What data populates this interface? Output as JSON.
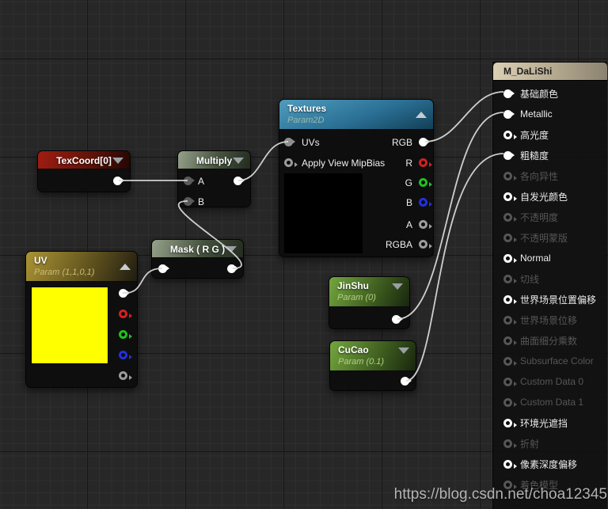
{
  "colors": {
    "canvas_bg": "#272727",
    "wire": "#d8d8d8",
    "header_texture_sample": "#2f7ca3",
    "header_constant_red": "#8a1410",
    "header_operator_green": "#5d7a3c",
    "header_param_green": "#5f9431",
    "header_param_gold": "#9a8527",
    "panel_header_tan": "#c9bda0",
    "pin_r": "#d42020",
    "pin_g": "#1ec21e",
    "pin_b": "#2330e2"
  },
  "nodes": {
    "texcoord": {
      "title": "TexCoord[0]"
    },
    "multiply": {
      "title": "Multiply",
      "inputs": [
        "A",
        "B"
      ]
    },
    "mask": {
      "title": "Mask ( R G )"
    },
    "textures": {
      "title": "Textures",
      "subtitle": "Param2D",
      "inputs": [
        "UVs",
        "Apply View MipBias"
      ],
      "outputs": [
        "RGB",
        "R",
        "G",
        "B",
        "A",
        "RGBA"
      ],
      "preview_color": "#000000"
    },
    "uv": {
      "title": "UV",
      "subtitle": "Param (1,1,0,1)",
      "preview_color": "#ffff00"
    },
    "jinshu": {
      "title": "JinShu",
      "subtitle": "Param (0)"
    },
    "cucao": {
      "title": "CuCao",
      "subtitle": "Param (0.1)"
    }
  },
  "panel": {
    "title": "M_DaLiShi",
    "items": [
      {
        "label": "基础颜色",
        "state": "linked"
      },
      {
        "label": "Metallic",
        "state": "linked"
      },
      {
        "label": "高光度",
        "state": "open"
      },
      {
        "label": "粗糙度",
        "state": "linked"
      },
      {
        "label": "各向异性",
        "state": "disabled"
      },
      {
        "label": "自发光颜色",
        "state": "open"
      },
      {
        "label": "不透明度",
        "state": "disabled"
      },
      {
        "label": "不透明蒙版",
        "state": "disabled"
      },
      {
        "label": "Normal",
        "state": "open"
      },
      {
        "label": "切线",
        "state": "disabled"
      },
      {
        "label": "世界场景位置偏移",
        "state": "open"
      },
      {
        "label": "世界场景位移",
        "state": "disabled"
      },
      {
        "label": "曲面细分乘数",
        "state": "disabled"
      },
      {
        "label": "Subsurface Color",
        "state": "disabled"
      },
      {
        "label": "Custom Data 0",
        "state": "disabled"
      },
      {
        "label": "Custom Data 1",
        "state": "disabled"
      },
      {
        "label": "环境光遮挡",
        "state": "open"
      },
      {
        "label": "折射",
        "state": "disabled"
      },
      {
        "label": "像素深度偏移",
        "state": "open"
      },
      {
        "label": "着色模型",
        "state": "disabled"
      }
    ]
  },
  "connections": [
    "TexCoord[0].out -> Multiply.A",
    "Mask(RG).out -> Multiply.B",
    "UV.rgb -> Mask(RG).in",
    "Multiply.out -> Textures.UVs",
    "Textures.RGB -> M_DaLiShi.基础颜色",
    "JinShu.out -> M_DaLiShi.Metallic",
    "CuCao.out -> M_DaLiShi.粗糙度"
  ],
  "watermark": "https://blog.csdn.net/choa12345"
}
